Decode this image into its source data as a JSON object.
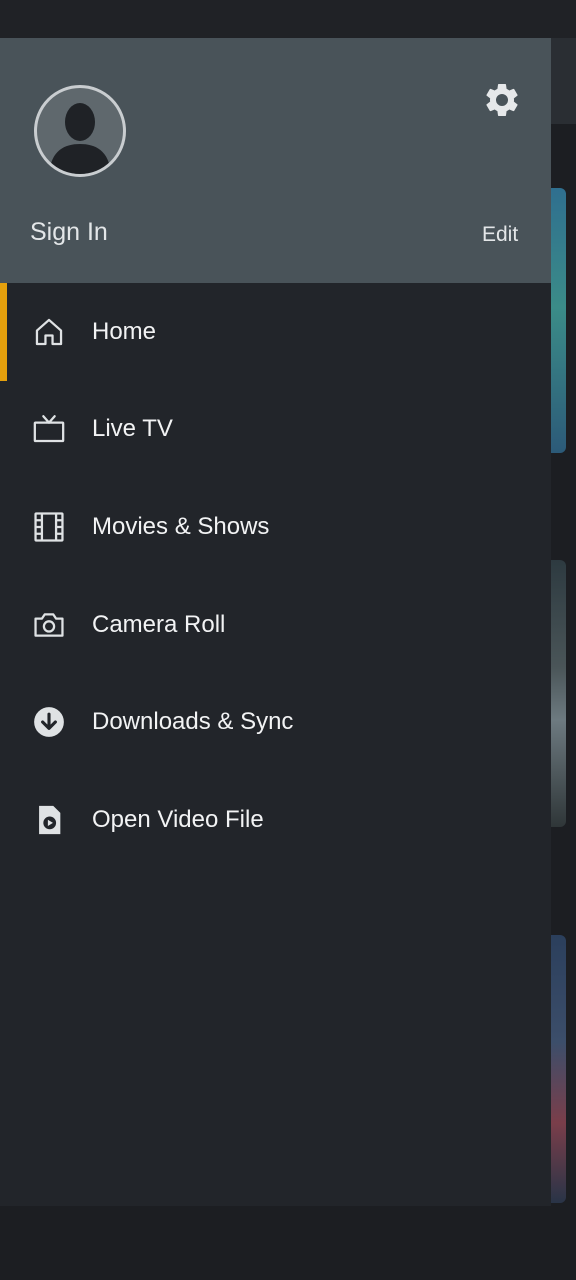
{
  "colors": {
    "accent": "#e5a00d",
    "drawer_bg": "#22252a",
    "header_bg": "#495359",
    "text": "#f2f3f4"
  },
  "header": {
    "avatar_icon": "user-avatar-icon",
    "settings_icon": "gear-icon",
    "sign_in_label": "Sign In",
    "edit_label": "Edit"
  },
  "menu": {
    "items": [
      {
        "label": "Home",
        "icon": "home-icon",
        "active": true
      },
      {
        "label": "Live TV",
        "icon": "tv-icon",
        "active": false
      },
      {
        "label": "Movies & Shows",
        "icon": "film-icon",
        "active": false
      },
      {
        "label": "Camera Roll",
        "icon": "camera-icon",
        "active": false
      },
      {
        "label": "Downloads & Sync",
        "icon": "download-circle-icon",
        "active": false
      },
      {
        "label": "Open Video File",
        "icon": "video-file-icon",
        "active": false
      }
    ]
  }
}
